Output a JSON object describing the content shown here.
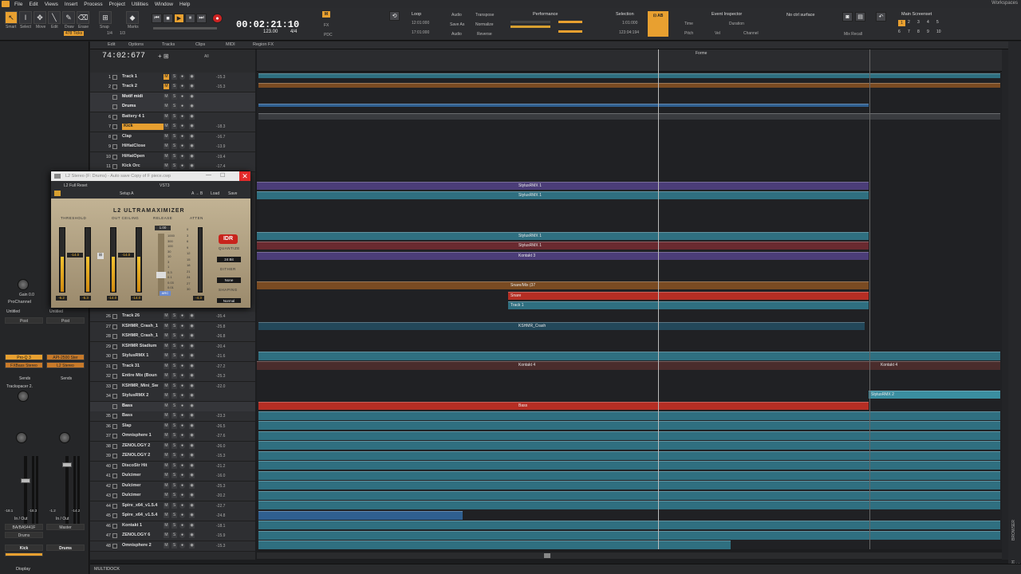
{
  "menu": [
    "File",
    "Edit",
    "Views",
    "Insert",
    "Process",
    "Project",
    "Utilities",
    "Window",
    "Help"
  ],
  "workspaces": "Workspaces",
  "tools": {
    "labels": [
      "Smart",
      "Select",
      "Move",
      "Edit",
      "Draw",
      "Erase"
    ],
    "ticks": "478 Ticks",
    "snap": "Snap",
    "marks": "Marks",
    "snap_value": "1/4",
    "snap_value2": "1/3"
  },
  "transport": {
    "time": "00:02:21:10",
    "tempo": "123.00",
    "meter": "4/4",
    "pdc": "PDC",
    "fx": "FX"
  },
  "loop": {
    "title": "Loop",
    "start": "12:01:000",
    "end": "17:01:000"
  },
  "audio_group": {
    "audio": "Audio",
    "save_as": "Save As",
    "audio2": "Audio",
    "transpose": "Transpose",
    "normalize": "Normalize",
    "reverse": "Reverse"
  },
  "performance": {
    "title": "Performance"
  },
  "selection": {
    "title": "Selection",
    "start": "1:01:000",
    "end": "123:04:194"
  },
  "event_inspector": {
    "title": "Event Inspector",
    "time": "Time",
    "duration": "Duration",
    "pitch": "Pitch",
    "vel": "Vel",
    "channel": "Channel"
  },
  "control_surface": {
    "value": "No ctrl surface",
    "mix_recall": "Mix Recall"
  },
  "screenset": {
    "title": "Main Screenset",
    "numbers": [
      "1",
      "2",
      "3",
      "4",
      "5",
      "6",
      "7",
      "8",
      "9",
      "10"
    ]
  },
  "trackview_menu": [
    "Edit",
    "Options",
    "Tracks",
    "Clips",
    "MIDI",
    "Region FX"
  ],
  "trackview_filter": "All",
  "now_time": "74:02:677",
  "tracks": [
    {
      "num": "1",
      "name": "Track 1",
      "vol": "-15.3",
      "mute": true
    },
    {
      "num": "2",
      "name": "Track 2",
      "vol": "-15.3",
      "mute": true
    },
    {
      "num": "",
      "name": "Motif midi",
      "vol": "",
      "mute": false,
      "folder": true
    },
    {
      "num": "",
      "name": "Drums",
      "vol": "",
      "mute": false,
      "folder": true
    },
    {
      "num": "6",
      "name": "Battery 4 1",
      "vol": "",
      "mute": false
    },
    {
      "num": "7",
      "name": "Kick",
      "vol": "-18.3",
      "mute": false,
      "selected": true
    },
    {
      "num": "8",
      "name": "Clap",
      "vol": "-16.7",
      "mute": false
    },
    {
      "num": "9",
      "name": "HiHatClose",
      "vol": "-13.9",
      "mute": false
    },
    {
      "num": "10",
      "name": "HiHatOpen",
      "vol": "-19.4",
      "mute": false
    },
    {
      "num": "11",
      "name": "Kick Orc",
      "vol": "-17.4",
      "mute": false
    },
    {
      "num": "26",
      "name": "Track 26",
      "vol": "-35.4",
      "mute": false
    },
    {
      "num": "27",
      "name": "KSHMR_Crash_1",
      "vol": "-25.8",
      "mute": false
    },
    {
      "num": "28",
      "name": "KSHMR_Crash_1",
      "vol": "-26.8",
      "mute": false
    },
    {
      "num": "29",
      "name": "KSHMR Stadium",
      "vol": "-20.4",
      "mute": false
    },
    {
      "num": "30",
      "name": "StylusRMX 1",
      "vol": "-21.6",
      "mute": false
    },
    {
      "num": "31",
      "name": "Track 31",
      "vol": "-27.2",
      "mute": false
    },
    {
      "num": "32",
      "name": "Entire Mix (Boun",
      "vol": "-25.3",
      "mute": false
    },
    {
      "num": "33",
      "name": "KSHMR_Mini_Sw",
      "vol": "-22.0",
      "mute": false
    },
    {
      "num": "34",
      "name": "StylusRMX 2",
      "vol": "",
      "mute": false
    },
    {
      "num": "",
      "name": "Bass",
      "vol": "",
      "mute": false,
      "folder": true
    },
    {
      "num": "35",
      "name": "Bass",
      "vol": "-23.3",
      "mute": false
    },
    {
      "num": "36",
      "name": "Slap",
      "vol": "-26.5",
      "mute": false
    },
    {
      "num": "37",
      "name": "Omnisphere 1",
      "vol": "-27.6",
      "mute": false
    },
    {
      "num": "38",
      "name": "ZENOLOGY 2",
      "vol": "-26.0",
      "mute": false
    },
    {
      "num": "39",
      "name": "ZENOLOGY 2",
      "vol": "-15.3",
      "mute": false
    },
    {
      "num": "40",
      "name": "DiscoStr Hit",
      "vol": "-21.2",
      "mute": false
    },
    {
      "num": "41",
      "name": "Dulcimer",
      "vol": "-16.0",
      "mute": false
    },
    {
      "num": "42",
      "name": "Dulcimer",
      "vol": "-25.3",
      "mute": false
    },
    {
      "num": "43",
      "name": "Dulcimer",
      "vol": "-20.2",
      "mute": false
    },
    {
      "num": "44",
      "name": "Spire_x64_v1.5.4",
      "vol": "-22.7",
      "mute": false
    },
    {
      "num": "45",
      "name": "Spire_x64_v1.5.4",
      "vol": "-24.8",
      "mute": false
    },
    {
      "num": "46",
      "name": "Kontakt 1",
      "vol": "-18.1",
      "mute": false
    },
    {
      "num": "47",
      "name": "ZENOLOGY 6",
      "vol": "-15.9",
      "mute": false
    },
    {
      "num": "48",
      "name": "Omnisphere 2",
      "vol": "-15.3",
      "mute": false
    }
  ],
  "clip_labels": {
    "stylus1": "StylusRMX 1",
    "stylus2": "StylusRMX 1",
    "stylus3": "StylusRMX 1",
    "stylus4": "StylusRMX 1",
    "kontakt3": "Kontakt 3",
    "snaremix": "Snare/Mix (37",
    "snare": "Snare",
    "track1": "Track 1",
    "kshmr": "KSHMR_Crash",
    "kontakt4a": "Kontakt 4",
    "kontakt4b": "Kontakt 4",
    "stylusrmx2": "StylusRMX 2",
    "bass": "Bass",
    "marker1": "Forme",
    "hsr": "HSR"
  },
  "inspector": {
    "prochannel": "ProChannel",
    "untitled1": "Untitled",
    "untitled2": "Untitled",
    "pro_q": "Pro-Q 3",
    "fabfilter": "FXBass Stereo",
    "api": "API-2500 Ster",
    "l2": "L2 Stereo",
    "sends": "Sends",
    "trackspacer": "Trackspacer 2.",
    "inout": "In / Out",
    "inout2": "In / Out",
    "input": "BA/BA5441F",
    "output": "Master",
    "drums_out": "Drums",
    "kick": "Kick",
    "drums": "Drums",
    "gain": "Gain",
    "gain_val": "0.0",
    "lvl1": "-18.1",
    "lvl2": "-18.3",
    "lvl3": "-1.2",
    "lvl4": "-14.2",
    "display": "Display"
  },
  "plugin": {
    "title": "L2 Stereo (F: Drums) - Auto save Copy of F piece.cwp",
    "preset": "L2 Full Reset",
    "vst": "VST3",
    "setup": "Setup A",
    "a_b": "A → B",
    "load": "Load",
    "save": "Save",
    "name": "L2 ULTRAMAXIMIZER",
    "threshold": "THRESHOLD",
    "out_ceiling": "OUT CEILING",
    "release": "RELEASE",
    "atten": "ATTEN",
    "thr_val": "-14.0",
    "ceil_val": "-14.0",
    "release_val": "1.00",
    "arc": "ARC",
    "quantize": "QUANTIZE",
    "bits": "24 Bit",
    "dither": "DITHER",
    "dither_val": "None",
    "shaping": "SHAPING",
    "shaping_val": "Normal",
    "idr": "IDR",
    "meter_labels": [
      "-6.2",
      "-5.3",
      "-14.0",
      "-14.0",
      "-4.3"
    ],
    "scale": [
      "1000",
      "300",
      "100",
      "30",
      "10",
      "3",
      "1",
      "0.3",
      "0.1",
      "0.03",
      "0.01"
    ],
    "atten_scale": [
      "0",
      "3",
      "6",
      "9",
      "12",
      "15",
      "18",
      "21",
      "24",
      "27",
      "30"
    ]
  },
  "bottom": {
    "multidock": "MULTIDOCK"
  },
  "right_panel": {
    "browser": "BROWSER",
    "synth_rack": "SYNTH RACK"
  },
  "colors": {
    "accent": "#e8a030",
    "selected": "#e8a030",
    "record": "#c22222",
    "clip_teal": "#2f6f80",
    "clip_red": "#b52e24"
  }
}
